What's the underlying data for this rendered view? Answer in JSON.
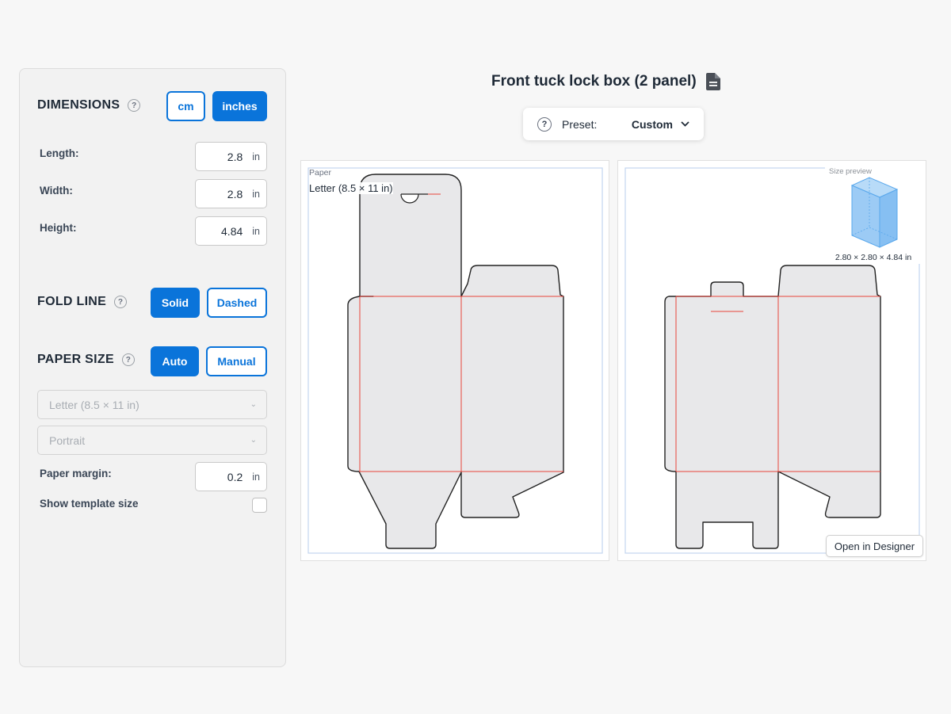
{
  "sidebar": {
    "dimensions": {
      "title": "DIMENSIONS",
      "unit_cm": "cm",
      "unit_inches": "inches",
      "selected_unit": "inches",
      "fields": [
        {
          "label": "Length:",
          "value": "2.8",
          "unit": "in"
        },
        {
          "label": "Width:",
          "value": "2.8",
          "unit": "in"
        },
        {
          "label": "Height:",
          "value": "4.84",
          "unit": "in"
        }
      ]
    },
    "fold_line": {
      "title": "FOLD LINE",
      "solid": "Solid",
      "dashed": "Dashed",
      "selected": "Solid"
    },
    "paper_size": {
      "title": "PAPER SIZE",
      "auto": "Auto",
      "manual": "Manual",
      "selected": "Auto",
      "paper_select": "Letter (8.5 × 11 in)",
      "orientation_select": "Portrait",
      "margin_label": "Paper margin:",
      "margin_value": "0.2",
      "margin_unit": "in",
      "template_size_label": "Show template size",
      "template_size_checked": false
    },
    "help_glyph": "?"
  },
  "header": {
    "title": "Front tuck lock box (2 panel)",
    "title_icon": "document-icon",
    "preset_label": "Preset:",
    "preset_value": "Custom"
  },
  "panels": {
    "left": {
      "paper_tag": "Paper",
      "paper_value": "Letter (8.5 × 11 in)"
    },
    "right": {
      "size_preview_caption": "Size preview",
      "size_preview_dims": "2.80 × 2.80 × 4.84 in",
      "open_button": "Open in Designer"
    }
  },
  "colors": {
    "accent": "#0a74da",
    "cut_line": "#1f1f1f",
    "fold_line": "#e8443a",
    "paper_border": "#c3d6ef",
    "panel_fill": "#e8e8ea",
    "preview_fill": "#9ccbf5"
  }
}
